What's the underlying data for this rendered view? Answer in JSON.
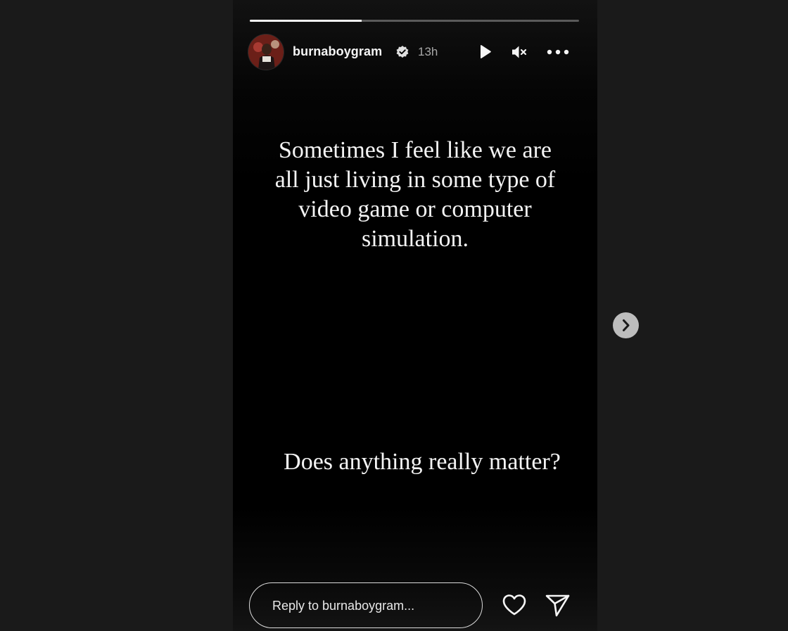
{
  "story": {
    "username": "burnaboygram",
    "time_ago": "13h",
    "progress_fraction": 0.34,
    "text_lines": [
      "Sometimes I feel like we are",
      "all just living in some type of",
      "video game or computer",
      "simulation."
    ],
    "text_bottom": "Does anything really matter?"
  },
  "reply": {
    "placeholder": "Reply to burnaboygram..."
  },
  "icons": {
    "verified": "verified-badge-icon",
    "play": "play-icon",
    "mute": "muted-speaker-icon",
    "more": "more-options-icon",
    "like": "heart-icon",
    "share": "send-icon",
    "next": "chevron-right-icon"
  },
  "colors": {
    "page_background": "#1a1a1a",
    "story_background": "#000000",
    "progress_fill": "#f5f5f5",
    "progress_track": "#5a5a5a",
    "next_button": "#bdbdbd"
  }
}
